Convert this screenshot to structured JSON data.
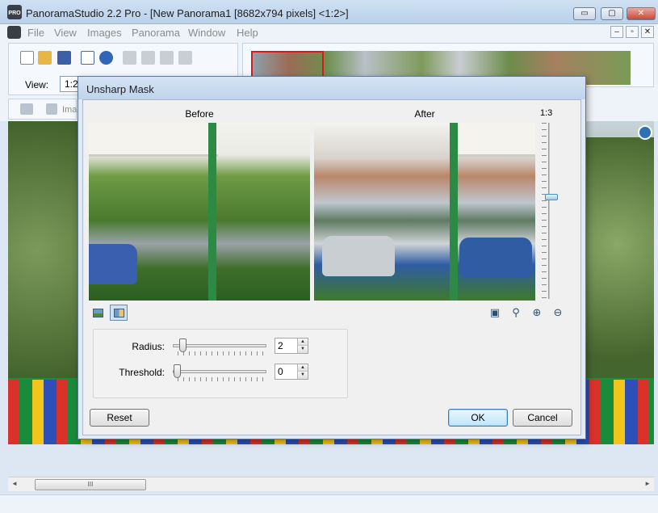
{
  "window": {
    "title": "PanoramaStudio 2.2 Pro - [New Panorama1 [8682x794 pixels] <1:2>]",
    "minimize_glyph": "▭",
    "maximize_glyph": "▢",
    "close_glyph": "✕"
  },
  "menubar": {
    "items": [
      "File",
      "View",
      "Images",
      "Panorama",
      "Window",
      "Help"
    ],
    "mdi": [
      "–",
      "▫",
      "✕"
    ]
  },
  "toolbar": {
    "view_label": "View:",
    "view_value": "1:2",
    "secondary_label": "Ima"
  },
  "dialog": {
    "title": "Unsharp Mask",
    "before_label": "Before",
    "after_label": "After",
    "zoom_label": "1:3",
    "radius": {
      "label": "Radius:",
      "value": "2"
    },
    "threshold": {
      "label": "Threshold:",
      "value": "0"
    },
    "reset_label": "Reset",
    "ok_label": "OK",
    "cancel_label": "Cancel"
  },
  "scroll": {
    "thumb_grip": "III",
    "left_arrow": "◄",
    "right_arrow": "►"
  },
  "colors": {
    "window_chrome": "#dce7f3",
    "close_button": "#c9483a",
    "minimap_selection": "#d41c1c",
    "default_button": "#3c7fb1"
  },
  "icons": [
    "new-icon",
    "open-icon",
    "save-icon",
    "info-icon",
    "help-icon",
    "rotate-icon",
    "zoom-in-icon",
    "zoom-out-icon",
    "split-view-icon"
  ]
}
